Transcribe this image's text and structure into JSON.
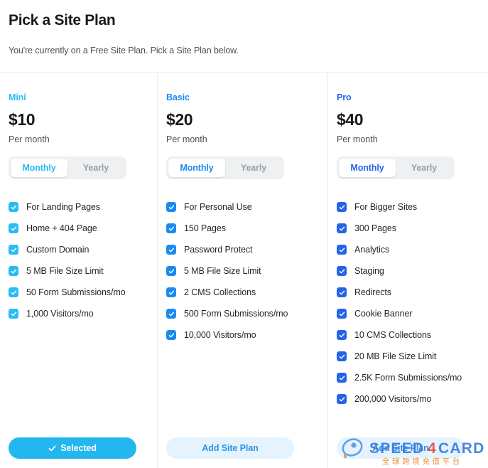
{
  "header": {
    "title": "Pick a Site Plan",
    "subtitle": "You're currently on a Free Site Plan. Pick a Site Plan below."
  },
  "colors": {
    "mini_accent": "#27bdf4",
    "basic_accent": "#1a8cf0",
    "pro_accent": "#2563eb",
    "text_primary": "#16191d",
    "text_muted": "#4a4f57",
    "toggle_inactive": "#9aa0a8",
    "divider": "#ececec"
  },
  "plans": [
    {
      "name": "Mini",
      "price": "$10",
      "period": "Per month",
      "accent": "#27bdf4",
      "billing": {
        "options": [
          "Monthly",
          "Yearly"
        ],
        "selected": "Monthly"
      },
      "features": [
        "For Landing Pages",
        "Home + 404 Page",
        "Custom Domain",
        "5 MB File Size Limit",
        "50 Form Submissions/mo",
        "1,000 Visitors/mo"
      ],
      "cta": {
        "label": "Selected",
        "state": "selected",
        "icon": "check-icon",
        "bg": "#23b7f0",
        "fg": "#ffffff"
      }
    },
    {
      "name": "Basic",
      "price": "$20",
      "period": "Per month",
      "accent": "#1a8cf0",
      "billing": {
        "options": [
          "Monthly",
          "Yearly"
        ],
        "selected": "Monthly"
      },
      "features": [
        "For Personal Use",
        "150 Pages",
        "Password Protect",
        "5 MB File Size Limit",
        "2 CMS Collections",
        "500 Form Submissions/mo",
        "10,000 Visitors/mo"
      ],
      "cta": {
        "label": "Add Site Plan",
        "state": "available",
        "icon": "",
        "bg": "#e4f3fd",
        "fg": "#2f93e0"
      }
    },
    {
      "name": "Pro",
      "price": "$40",
      "period": "Per month",
      "accent": "#2563eb",
      "billing": {
        "options": [
          "Monthly",
          "Yearly"
        ],
        "selected": "Monthly"
      },
      "features": [
        "For Bigger Sites",
        "300 Pages",
        "Analytics",
        "Staging",
        "Redirects",
        "Cookie Banner",
        "10 CMS Collections",
        "20 MB File Size Limit",
        "2.5K Form Submissions/mo",
        "200,000 Visitors/mo"
      ],
      "cta": {
        "label": "Add Site Plan",
        "state": "available",
        "icon": "",
        "bg": "#e4f3fd",
        "fg": "#2f93e0"
      }
    }
  ],
  "watermark": {
    "brand_part1": "SPEED",
    "brand_part2": "CARD",
    "brand_mark": "4",
    "tagline": "全球跨境充值平台",
    "icon": "rocket-icon",
    "color": "#3b7de0",
    "accent": "#f0832a"
  }
}
